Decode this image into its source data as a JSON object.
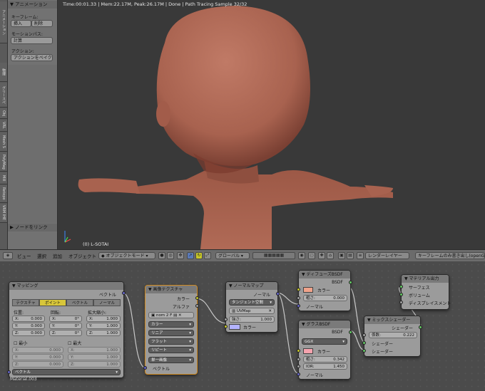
{
  "viewport": {
    "info": "Time:00:01.33 | Mem:22.17M, Peak:26.17M | Done | Path Tracing Sample 32/32",
    "object_label": "(0) L-SOTAI"
  },
  "shelf": {
    "tabs": [
      "アニメーション",
      "物理",
      "グリースペ",
      "Obj",
      "VRL",
      "Mesh S",
      "PolyMag",
      "Mill",
      "Retopo",
      "VRM IHE"
    ],
    "panel_title": "アニメーション",
    "keyframe_label": "キーフレーム:",
    "insert": "挿入",
    "delete": "削除",
    "motion_path_label": "モーションパス:",
    "calculate": "計算",
    "action_label": "アクション:",
    "bake_action": "アクションをベイク",
    "link_nodes": "ノードをリンク"
  },
  "header3d": {
    "menus": [
      "ビュー",
      "選択",
      "追加",
      "オブジェクト"
    ],
    "mode": "オブジェクトモード",
    "orientation": "グローバル",
    "render_layer": "レンダーレイヤー",
    "keyframe_dropdown": "キーフレームのみ書き出し(openGL"
  },
  "nodes": {
    "mapping": {
      "title": "マッピング",
      "out_vector": "ベクトル",
      "tabs": [
        "テクスチャ",
        "ポイント",
        "ベクトル",
        "ノーマル"
      ],
      "location_label": "位置:",
      "rotation_label": "回転:",
      "scale_label": "拡大縮小:",
      "loc": [
        "X:",
        "0.000",
        "Y:",
        "0.000",
        "Z:",
        "0.000"
      ],
      "rot": [
        "X:",
        "0°",
        "Y:",
        "0°",
        "Z:",
        "0°"
      ],
      "scl": [
        "X:",
        "1.000",
        "Y:",
        "1.000",
        "Z:",
        "1.000"
      ],
      "min_label": "最小",
      "max_label": "最大",
      "min": [
        "X:",
        "0.000",
        "Y:",
        "0.000",
        "Z:",
        "0.000"
      ],
      "max": [
        "X:",
        "1.000",
        "Y:",
        "1.000",
        "Z:",
        "1.000"
      ],
      "in_vector": "ベクトル"
    },
    "image_texture": {
      "title": "画像テクスチャ",
      "out_color": "カラー",
      "out_alpha": "アルファ",
      "image_name": "nom",
      "users": "2",
      "fake_user": "F",
      "color_space": "カラー",
      "interpolation": "リニア",
      "projection": "フラット",
      "extension": "リピート",
      "source": "単一画像",
      "in_vector": "ベクトル"
    },
    "normal_map": {
      "title": "ノーマルマップ",
      "out_normal": "ノーマル",
      "space": "タンジェント空間",
      "uv_map": "UVMap",
      "strength_label": "強さ:",
      "strength_value": "1.000",
      "in_color": "カラー"
    },
    "diffuse": {
      "title": "ディフューズBSDF",
      "out_bsdf": "BSDF",
      "color_label": "カラー",
      "roughness_label": "粗さ:",
      "roughness_value": "0.000",
      "normal_label": "ノーマル"
    },
    "glass": {
      "title": "グラスBSDF",
      "out_bsdf": "BSDF",
      "distribution": "GGX",
      "color_label": "カラー",
      "roughness_label": "粗さ:",
      "roughness_value": "0.342",
      "ior_label": "IOR:",
      "ior_value": "1.450",
      "normal_label": "ノーマル"
    },
    "mix_shader": {
      "title": "ミックスシェーダー",
      "out_shader": "シェーダー",
      "fac_label": "係数:",
      "fac_value": "0.222",
      "in_shader1": "シェーダー",
      "in_shader2": "シェーダー"
    },
    "material_output": {
      "title": "マテリアル出力",
      "surface": "サーフェス",
      "volume": "ボリューム",
      "displacement": "ディスプレイスメント"
    },
    "material_name": "Material.003"
  },
  "colors": {
    "skin": "#b9725e",
    "skin_shadow": "#8e4f3f",
    "diffuse_swatch": "#f0a38b",
    "glass_swatch": "#f5a3ae",
    "normal_swatch": "#b3b3ff"
  }
}
